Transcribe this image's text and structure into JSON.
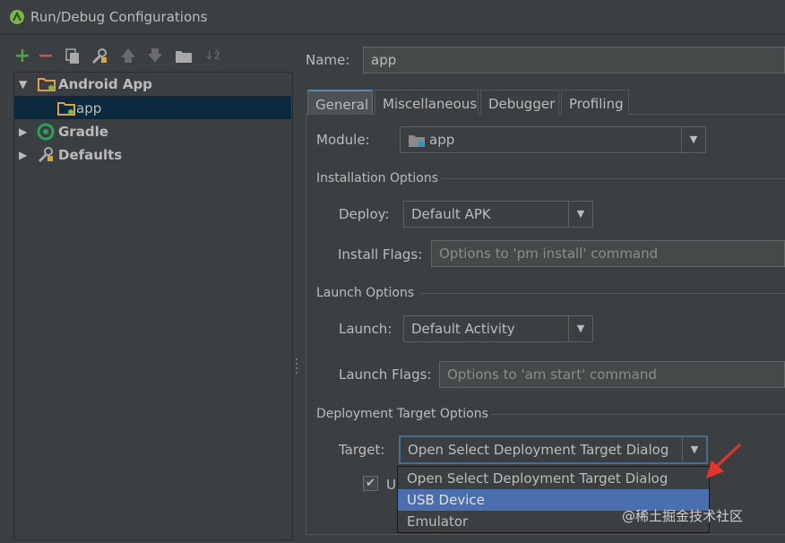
{
  "window": {
    "title": "Run/Debug Configurations"
  },
  "toolbar": {
    "icons": [
      "add-icon",
      "remove-icon",
      "copy-icon",
      "edit-defaults-icon",
      "move-up-icon",
      "move-down-icon",
      "folder-icon",
      "sort-icon"
    ],
    "colors": {
      "add": "#4fa14a",
      "remove": "#c75450"
    }
  },
  "tree": {
    "items": [
      {
        "label": "Android App",
        "icon": "android-app-folder-icon",
        "expanded": true
      },
      {
        "label": "app",
        "icon": "app-module-icon",
        "selected": true
      },
      {
        "label": "Gradle",
        "icon": "gradle-icon",
        "expanded": false
      },
      {
        "label": "Defaults",
        "icon": "wrench-icon",
        "expanded": false
      }
    ]
  },
  "name_field": {
    "label": "Name:",
    "value": "app"
  },
  "tabs": [
    {
      "label": "General",
      "active": true
    },
    {
      "label": "Miscellaneous"
    },
    {
      "label": "Debugger"
    },
    {
      "label": "Profiling"
    }
  ],
  "general": {
    "module": {
      "label": "Module:",
      "value": "app"
    },
    "installation": {
      "header": "Installation Options",
      "deploy_label": "Deploy:",
      "deploy_value": "Default APK",
      "flags_label": "Install Flags:",
      "flags_placeholder": "Options to 'pm install' command"
    },
    "launch": {
      "header": "Launch Options",
      "launch_label": "Launch:",
      "launch_value": "Default Activity",
      "flags_label": "Launch Flags:",
      "flags_placeholder": "Options to 'am start' command"
    },
    "deployment": {
      "header": "Deployment Target Options",
      "target_label": "Target:",
      "target_value": "Open Select Deployment Target Dialog",
      "checkbox_partial_label": "U",
      "checkbox_checked": true,
      "dropdown_options": [
        "Open Select Deployment Target Dialog",
        "USB Device",
        "Emulator"
      ],
      "dropdown_highlighted": "USB Device"
    }
  },
  "watermark": "@稀土掘金技术社区",
  "colors": {
    "selection": "#4b6eaf",
    "tree_selection": "#0d293e",
    "annotation_arrow": "#e8322c"
  }
}
